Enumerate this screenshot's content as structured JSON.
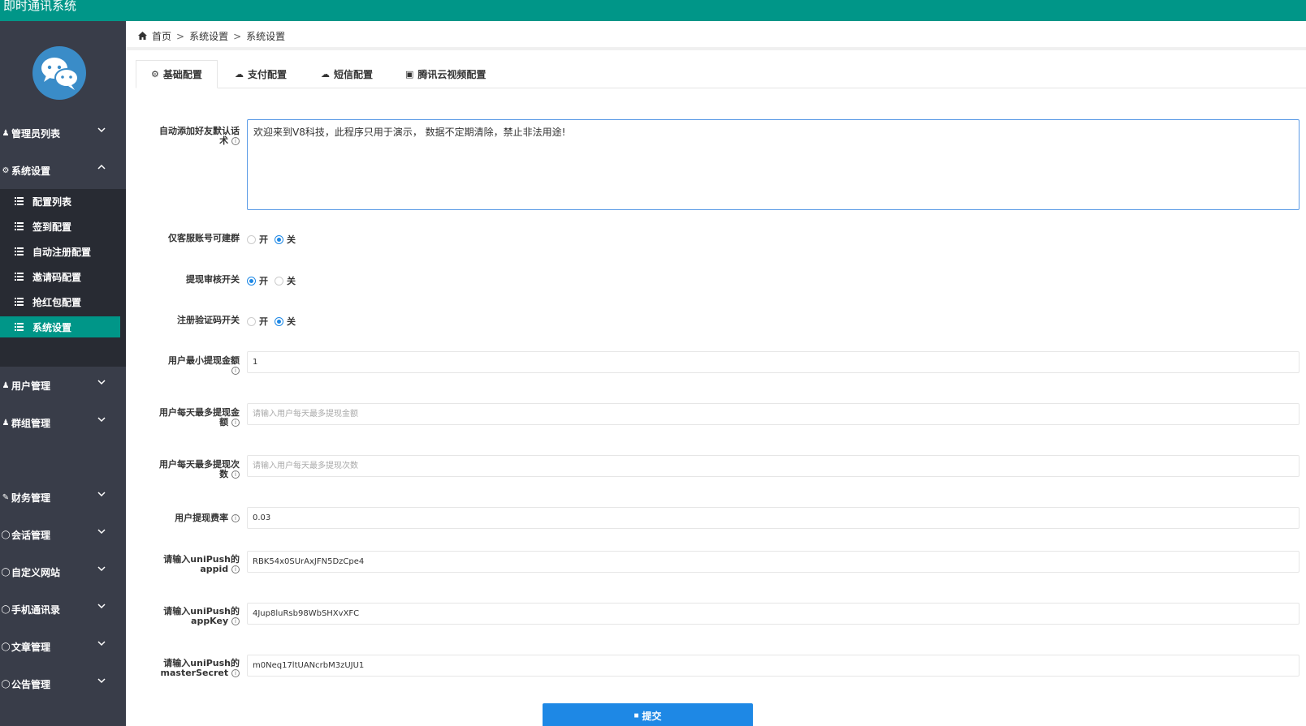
{
  "app": {
    "title": "即时通讯系统"
  },
  "colors": {
    "topbar": "#009688",
    "sidebar": "#393d49",
    "submenu": "#282b33",
    "active": "#009688",
    "primary": "#1e88e5"
  },
  "sidebar": {
    "logo": "wechat-logo",
    "items": [
      {
        "label": "管理员列表",
        "icon": "user-icon"
      },
      {
        "label": "系统设置",
        "icon": "gear-icon",
        "expanded": true
      },
      {
        "label": "用户管理",
        "icon": "user-icon"
      },
      {
        "label": "群组管理",
        "icon": "users-icon"
      },
      {
        "label": "财务管理",
        "icon": "edit-icon"
      },
      {
        "label": "会话管理",
        "icon": "chat-icon"
      },
      {
        "label": "自定义网站",
        "icon": "chat-icon"
      },
      {
        "label": "手机通讯录",
        "icon": "chat-icon"
      },
      {
        "label": "文章管理",
        "icon": "chat-icon"
      },
      {
        "label": "公告管理",
        "icon": "chat-icon"
      }
    ],
    "subitems": [
      {
        "label": "配置列表"
      },
      {
        "label": "签到配置"
      },
      {
        "label": "自动注册配置"
      },
      {
        "label": "邀请码配置"
      },
      {
        "label": "抢红包配置"
      },
      {
        "label": "系统设置",
        "active": true
      }
    ]
  },
  "breadcrumb": {
    "home": "首页",
    "sep": ">",
    "items": [
      "系统设置",
      "系统设置"
    ]
  },
  "tabs": [
    {
      "label": "基础配置",
      "icon": "gear-icon",
      "active": true
    },
    {
      "label": "支付配置",
      "icon": "cloud-icon"
    },
    {
      "label": "短信配置",
      "icon": "cloud-icon"
    },
    {
      "label": "腾讯云视频配置",
      "icon": "cube-icon"
    }
  ],
  "form": {
    "greeting": {
      "label_line1": "自动添加好友默认话",
      "label_line2": "术",
      "value": "欢迎来到V8科技，此程序只用于演示， 数据不定期清除，禁止非法用途!"
    },
    "only_cs_group": {
      "label": "仅客服账号可建群",
      "on": "开",
      "off": "关",
      "selected": "off"
    },
    "withdraw_review": {
      "label": "提现审核开关",
      "on": "开",
      "off": "关",
      "selected": "on"
    },
    "register_captcha": {
      "label": "注册验证码开关",
      "on": "开",
      "off": "关",
      "selected": "off"
    },
    "min_withdraw": {
      "label_line1": "用户最小提现金额",
      "value": "1",
      "placeholder": ""
    },
    "max_daily_amount": {
      "label_line1": "用户每天最多提现金",
      "label_line2": "额",
      "value": "",
      "placeholder": "请输入用户每天最多提现金额"
    },
    "max_daily_times": {
      "label_line1": "用户每天最多提现次",
      "label_line2": "数",
      "value": "",
      "placeholder": "请输入用户每天最多提现次数"
    },
    "withdraw_fee": {
      "label_line1": "用户提现费率",
      "value": "0.03",
      "placeholder": ""
    },
    "unipush_appid": {
      "label_line1": "请输入uniPush的",
      "label_line2": "appid",
      "value": "RBK54x0SUrAxJFN5DzCpe4"
    },
    "unipush_appkey": {
      "label_line1": "请输入uniPush的",
      "label_line2": "appKey",
      "value": "4Jup8luRsb98WbSHXvXFC"
    },
    "unipush_master": {
      "label_line1": "请输入uniPush的",
      "label_line2": "masterSecret",
      "value": "m0Neq17ltUANcrbM3zUJU1"
    },
    "submit": {
      "label": "提交"
    }
  }
}
